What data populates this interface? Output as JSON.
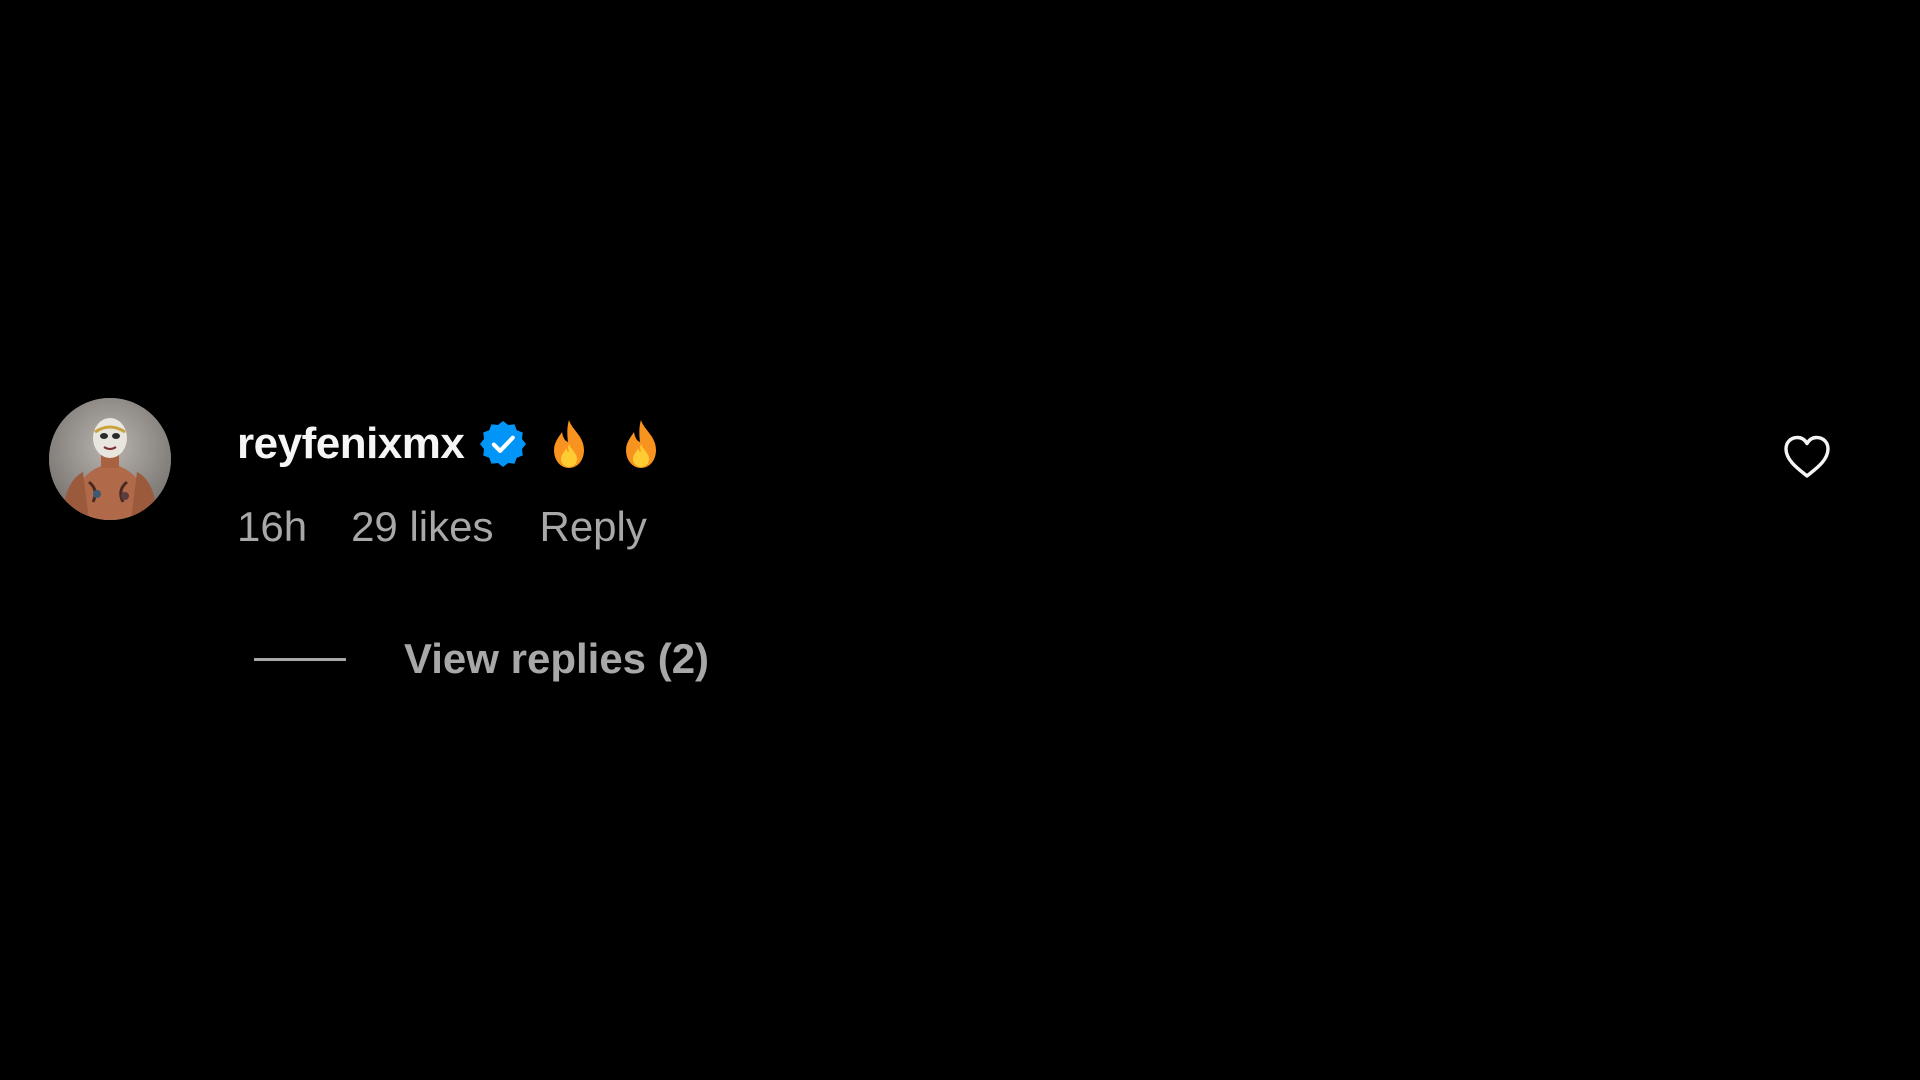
{
  "comment": {
    "username": "reyfenixmx",
    "verified": true,
    "emojis": [
      "fire-icon",
      "fire-icon"
    ],
    "timestamp": "16h",
    "likes": "29 likes",
    "reply_label": "Reply",
    "view_replies_label": "View replies (2)"
  },
  "colors": {
    "background": "#000000",
    "username": "#f5f5f5",
    "secondary_text": "#a8a8a8",
    "verified_badge": "#0095f6",
    "fire_outer": "#f7931e",
    "fire_inner": "#ffcc33"
  }
}
